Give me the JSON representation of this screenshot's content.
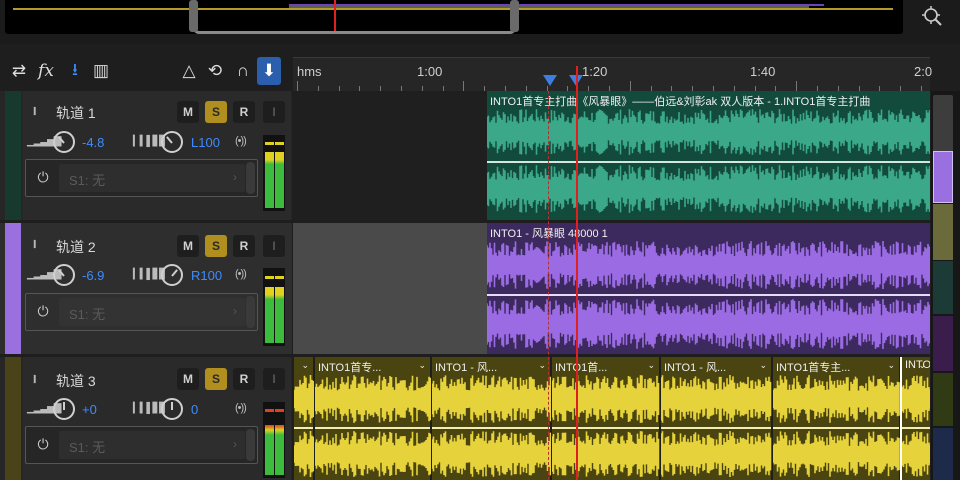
{
  "ruler": {
    "unit": "hms",
    "ticks": [
      "1:00",
      "1:20",
      "1:40",
      "2:0"
    ]
  },
  "tracks": [
    {
      "name": "轨道 1",
      "mute": "M",
      "solo": "S",
      "record": "R",
      "input": "I",
      "volume": "-4.8",
      "pan": "L100",
      "fx_slot": "S1: 无",
      "color": "#2d8a6b",
      "clips": [
        {
          "title": "INTO1首专主打曲《风暴眼》——伯远&刘彰ak 双人版本 - 1.INTO1首专主打曲",
          "color": "#3aa889"
        }
      ]
    },
    {
      "name": "轨道 2",
      "mute": "M",
      "solo": "S",
      "record": "R",
      "input": "I",
      "volume": "-6.9",
      "pan": "R100",
      "fx_slot": "S1: 无",
      "color": "#9a6fe0",
      "clips": [
        {
          "title": "INTO1 - 风暴眼 48000 1",
          "color": "#9b6be3"
        }
      ]
    },
    {
      "name": "轨道 3",
      "mute": "M",
      "solo": "S",
      "record": "R",
      "input": "I",
      "volume": "+0",
      "pan": "0",
      "fx_slot": "S1: 无",
      "color": "#b3a020",
      "clips": [
        {
          "title": ""
        },
        {
          "title": "INTO1首专..."
        },
        {
          "title": "INTO1 - 风..."
        },
        {
          "title": "INTO1首..."
        },
        {
          "title": "INTO1 - 风..."
        },
        {
          "title": "INTO1首专主..."
        },
        {
          "title": "INTO"
        }
      ]
    }
  ],
  "colors": {
    "accent": "#3d8cff",
    "playhead": "#e02020",
    "solo_active": "#b08f1e",
    "track3_clip": "#e6d23a"
  },
  "icons": [
    "loop-icon",
    "fx-icon",
    "routing-icon",
    "levels-icon",
    "metronome-icon",
    "snap-icon",
    "magnet-icon",
    "marker-icon",
    "zoom-icon",
    "waveform-icon",
    "power-icon"
  ]
}
